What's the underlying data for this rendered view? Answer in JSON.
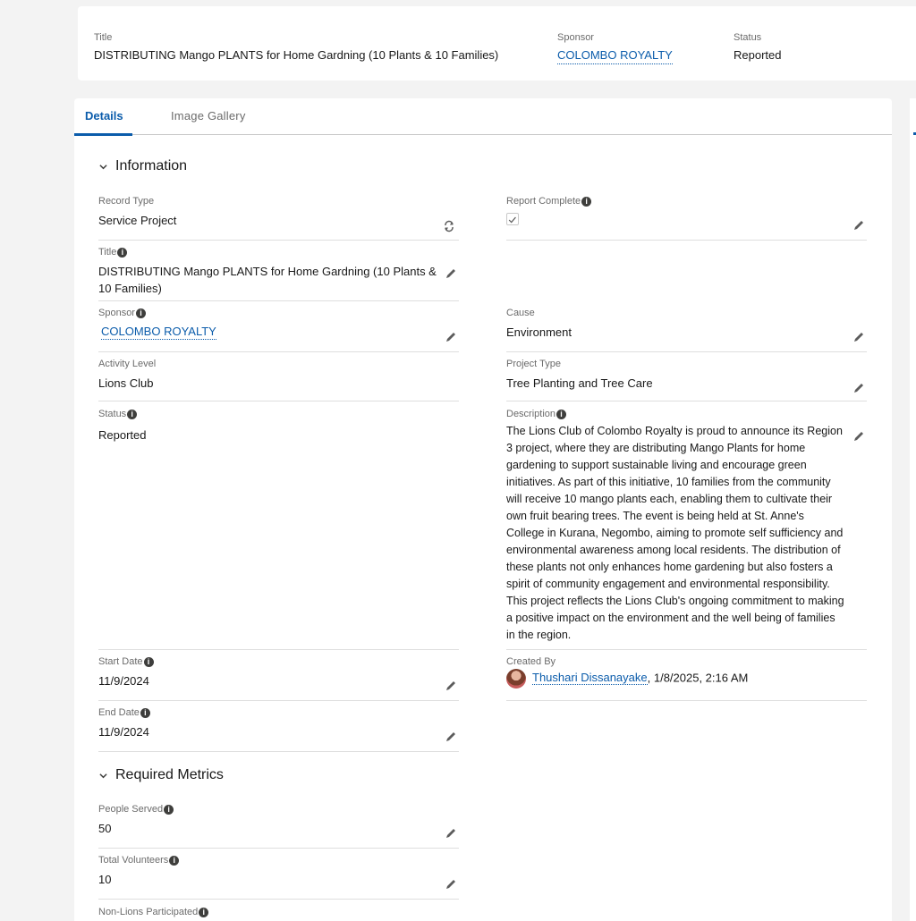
{
  "highlights": {
    "title_label": "Title",
    "title_value": "DISTRIBUTING Mango PLANTS for Home Gardning (10 Plants & 10 Families)",
    "sponsor_label": "Sponsor",
    "sponsor_value": "COLOMBO ROYALTY",
    "status_label": "Status",
    "status_value": "Reported"
  },
  "tabs": [
    {
      "label": "Details",
      "active": true
    },
    {
      "label": "Image Gallery",
      "active": false
    }
  ],
  "sections": {
    "information": "Information",
    "required_metrics": "Required Metrics"
  },
  "fields": {
    "record_type": {
      "label": "Record Type",
      "value": "Service Project"
    },
    "report_complete": {
      "label": "Report Complete",
      "value": "checked"
    },
    "title": {
      "label": "Title",
      "value": "DISTRIBUTING Mango PLANTS for Home Gardning (10 Plants & 10 Families)"
    },
    "sponsor": {
      "label": "Sponsor",
      "value": "COLOMBO ROYALTY"
    },
    "cause": {
      "label": "Cause",
      "value": "Environment"
    },
    "activity_level": {
      "label": "Activity Level",
      "value": "Lions Club"
    },
    "project_type": {
      "label": "Project Type",
      "value": "Tree Planting and Tree Care"
    },
    "status": {
      "label": "Status",
      "value": "Reported"
    },
    "description": {
      "label": "Description",
      "value": "The Lions Club of Colombo Royalty is proud to announce its Region 3 project, where they are distributing Mango Plants for home gardening to support sustainable living and encourage green initiatives. As part of this initiative, 10 families from the community will receive 10 mango plants each, enabling them to cultivate their own fruit bearing trees. The event is being held at St. Anne's College in Kurana, Negombo, aiming to promote self sufficiency and environmental awareness among local residents. The distribution of these plants not only enhances home gardening but also fosters a spirit of community engagement and environmental responsibility. This project reflects the Lions Club's ongoing commitment to making a positive impact on the environment and the well being of families in the region."
    },
    "start_date": {
      "label": "Start Date",
      "value": "11/9/2024"
    },
    "created_by": {
      "label": "Created By",
      "user": "Thushari Dissanayake",
      "timestamp": ", 1/8/2025, 2:16 AM"
    },
    "end_date": {
      "label": "End Date",
      "value": "11/9/2024"
    },
    "people_served": {
      "label": "People Served",
      "value": "50"
    },
    "total_volunteers": {
      "label": "Total Volunteers",
      "value": "10"
    },
    "non_lions_participated": {
      "label": "Non-Lions Participated",
      "value": ""
    }
  },
  "icons": {
    "info": "info-icon",
    "edit": "pencil-icon",
    "refresh": "refresh-icon",
    "chevron": "chevron-down-icon"
  },
  "colors": {
    "accent": "#0b5cab",
    "background": "#f3f3f3"
  }
}
